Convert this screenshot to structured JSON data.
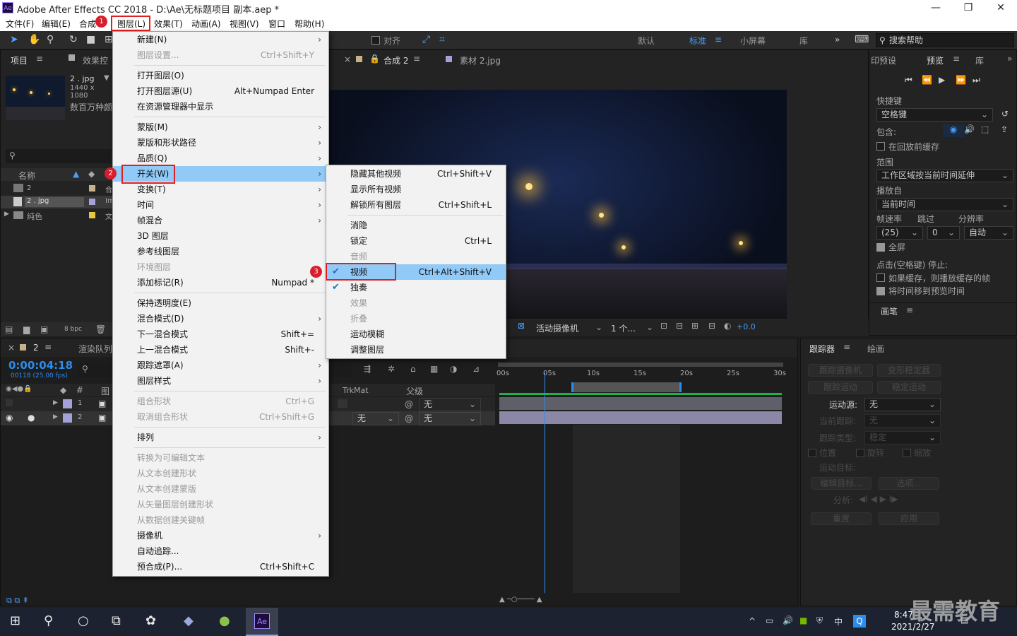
{
  "window": {
    "title": "Adobe After Effects CC 2018 - D:\\Ae\\无标题项目 副本.aep *",
    "app_icon": "Ae",
    "controls": [
      "—",
      "❐",
      "✕"
    ]
  },
  "menubar": {
    "items": [
      "文件(F)",
      "编辑(E)",
      "合成",
      "图层(L)",
      "效果(T)",
      "动画(A)",
      "视图(V)",
      "窗口",
      "帮助(H)"
    ]
  },
  "badges": [
    "1",
    "2",
    "3"
  ],
  "toolbar": {
    "snap_label": "对齐",
    "workspaces": [
      "默认",
      "标准",
      "小屏幕",
      "库"
    ],
    "search_placeholder": "搜索帮助"
  },
  "project": {
    "tabs": [
      "项目",
      "效果控"
    ],
    "preview_name": "2 . jpg",
    "preview_dims": "1440 x 1080",
    "preview_desc": "数百万种颜",
    "col_name": "名称",
    "items": [
      {
        "name": "2",
        "type": "合"
      },
      {
        "name": "2 . jpg",
        "type": "Im"
      },
      {
        "name": "纯色",
        "type": "文"
      }
    ],
    "bpc": "8 bpc"
  },
  "viewer": {
    "tabs": [
      "合成 2",
      "素材 2.jpg"
    ],
    "camera": "活动摄像机",
    "views": "1 个...",
    "exposure": "+0.0"
  },
  "layer_menu": {
    "items": [
      {
        "label": "新建(N)",
        "arrow": true
      },
      {
        "label": "图层设置...",
        "shortcut": "Ctrl+Shift+Y",
        "disabled": true
      },
      {
        "label": "打开图层(O)"
      },
      {
        "label": "打开图层源(U)",
        "shortcut": "Alt+Numpad Enter"
      },
      {
        "label": "在资源管理器中显示"
      },
      {
        "label": "蒙版(M)",
        "arrow": true
      },
      {
        "label": "蒙版和形状路径",
        "arrow": true
      },
      {
        "label": "品质(Q)",
        "arrow": true
      },
      {
        "label": "开关(W)",
        "arrow": true
      },
      {
        "label": "变换(T)",
        "arrow": true
      },
      {
        "label": "时间",
        "arrow": true
      },
      {
        "label": "帧混合",
        "arrow": true
      },
      {
        "label": "3D 图层"
      },
      {
        "label": "参考线图层"
      },
      {
        "label": "环境图层",
        "disabled": true
      },
      {
        "label": "添加标记(R)",
        "shortcut": "Numpad *"
      },
      {
        "label": "保持透明度(E)"
      },
      {
        "label": "混合模式(D)",
        "arrow": true
      },
      {
        "label": "下一混合模式",
        "shortcut": "Shift+="
      },
      {
        "label": "上一混合模式",
        "shortcut": "Shift+-"
      },
      {
        "label": "跟踪遮罩(A)",
        "arrow": true
      },
      {
        "label": "图层样式",
        "arrow": true
      },
      {
        "label": "组合形状",
        "shortcut": "Ctrl+G",
        "disabled": true
      },
      {
        "label": "取消组合形状",
        "shortcut": "Ctrl+Shift+G",
        "disabled": true
      },
      {
        "label": "排列",
        "arrow": true
      },
      {
        "label": "转换为可编辑文本",
        "disabled": true
      },
      {
        "label": "从文本创建形状",
        "disabled": true
      },
      {
        "label": "从文本创建蒙版",
        "disabled": true
      },
      {
        "label": "从矢量图层创建形状",
        "disabled": true
      },
      {
        "label": "从数据创建关键帧",
        "disabled": true
      },
      {
        "label": "摄像机",
        "arrow": true
      },
      {
        "label": "自动追踪..."
      },
      {
        "label": "预合成(P)...",
        "shortcut": "Ctrl+Shift+C"
      }
    ]
  },
  "switch_menu": {
    "items": [
      {
        "label": "隐藏其他视频",
        "shortcut": "Ctrl+Shift+V"
      },
      {
        "label": "显示所有视频"
      },
      {
        "label": "解锁所有图层",
        "shortcut": "Ctrl+Shift+L"
      },
      {
        "label": "消隐"
      },
      {
        "label": "锁定",
        "shortcut": "Ctrl+L"
      },
      {
        "label": "音频",
        "disabled": true
      },
      {
        "label": "视频",
        "shortcut": "Ctrl+Alt+Shift+V",
        "checked": true
      },
      {
        "label": "独奏",
        "checked": true
      },
      {
        "label": "效果",
        "disabled": true
      },
      {
        "label": "折叠",
        "disabled": true
      },
      {
        "label": "运动模糊"
      },
      {
        "label": "调整图层"
      }
    ]
  },
  "preview_panel": {
    "tabs": [
      "印预设",
      "预览",
      "库"
    ],
    "shortcut_label": "快捷键",
    "shortcut_value": "空格键",
    "include_label": "包含:",
    "cache_label": "在回放前缓存",
    "range_label": "范围",
    "range_value": "工作区域按当前时间延伸",
    "playfrom_label": "播放自",
    "playfrom_value": "当前时间",
    "fps_label": "帧速率",
    "skip_label": "跳过",
    "res_label": "分辨率",
    "fps_value": "(25)",
    "skip_value": "0",
    "res_value": "自动",
    "fullscreen_label": "全屏",
    "stop_label": "点击(空格键) 停止:",
    "opt1": "如果缓存，则播放缓存的帧",
    "opt2": "将时间移到预览时间",
    "brush_tab": "画笔"
  },
  "timeline": {
    "tabs": [
      "2",
      "渲染队列"
    ],
    "timecode": "0:00:04:18",
    "frameinfo": "00118 (25.00 fps)",
    "col_trkmat": "TrkMat",
    "col_parent": "父级",
    "col_source": "图",
    "layers": [
      {
        "num": "1",
        "trkmat": "",
        "parent": "无"
      },
      {
        "num": "2",
        "trkmat": "无",
        "parent": "无"
      }
    ],
    "ruler": [
      "00s",
      "05s",
      "10s",
      "15s",
      "20s",
      "25s",
      "30s"
    ]
  },
  "tracker": {
    "tabs": [
      "跟踪器",
      "绘画"
    ],
    "btn_track_camera": "跟踪摄像机",
    "btn_warp": "变形稳定器",
    "btn_track_motion": "跟踪运动",
    "btn_stabilize": "稳定运动",
    "motion_source_label": "运动源:",
    "motion_source": "无",
    "current_track_label": "当前跟踪:",
    "current_track": "无",
    "track_type_label": "跟踪类型:",
    "track_type": "稳定",
    "pos": "位置",
    "rot": "旋转",
    "scale": "缩放",
    "target_label": "运动目标:",
    "edit_target": "编辑目标...",
    "options": "选项...",
    "analyze_label": "分析:",
    "reset": "重置",
    "apply": "应用"
  },
  "taskbar": {
    "time": "8:47",
    "date": "2021/2/27",
    "ime": "中",
    "watermark": "最需教育"
  },
  "colors": {
    "accent": "#2d8ceb",
    "highlight": "#91c9f7",
    "red": "#e02020",
    "timecode": "#2d8ceb",
    "green": "#1bb24e"
  }
}
